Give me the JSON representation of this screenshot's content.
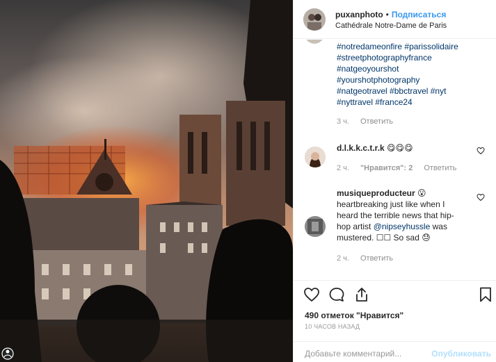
{
  "post": {
    "username": "puxanphoto",
    "separator": "•",
    "follow_label": "Подписаться",
    "location": "Cathédrale Notre-Dame de Paris"
  },
  "caption": {
    "hashtags": [
      "#notredameonfire #parissolidaire",
      "#streetphotographyfrance",
      "#natgeoyourshot",
      "#yourshotphotography",
      "#natgeotravel #bbctravel #nyt",
      "#nyttravel #france24"
    ],
    "time": "3 ч.",
    "reply_label": "Ответить"
  },
  "comments": [
    {
      "username": "d.l.k.k.c.t.r.k",
      "text": "😋😋😋",
      "time": "2 ч.",
      "likes": "\"Нравится\": 2",
      "reply_label": "Ответить"
    },
    {
      "username": "musiqueproducteur",
      "text_line1_after_user": " 😮",
      "text_lines": [
        "heartbreaking just like when I",
        "heard the terrible news that hip-",
        "hop artist ",
        "mustered. ☐☐ So sad 😓"
      ],
      "mention": "@nipseyhussle",
      "mention_after": " was",
      "time": "2 ч.",
      "reply_label": "Ответить"
    }
  ],
  "actions": {
    "likes_text": "490 отметок \"Нравится\"",
    "time_ago": "10 ЧАСОВ НАЗАД",
    "comment_placeholder": "Добавьте комментарий...",
    "post_button": "Опубликовать"
  },
  "icons": {
    "like": "heart-icon",
    "comment": "comment-icon",
    "share": "share-icon",
    "save": "bookmark-icon"
  },
  "colors": {
    "link": "#003569",
    "follow": "#3897f0",
    "muted": "#999999",
    "post_disabled": "#b2dffc"
  }
}
